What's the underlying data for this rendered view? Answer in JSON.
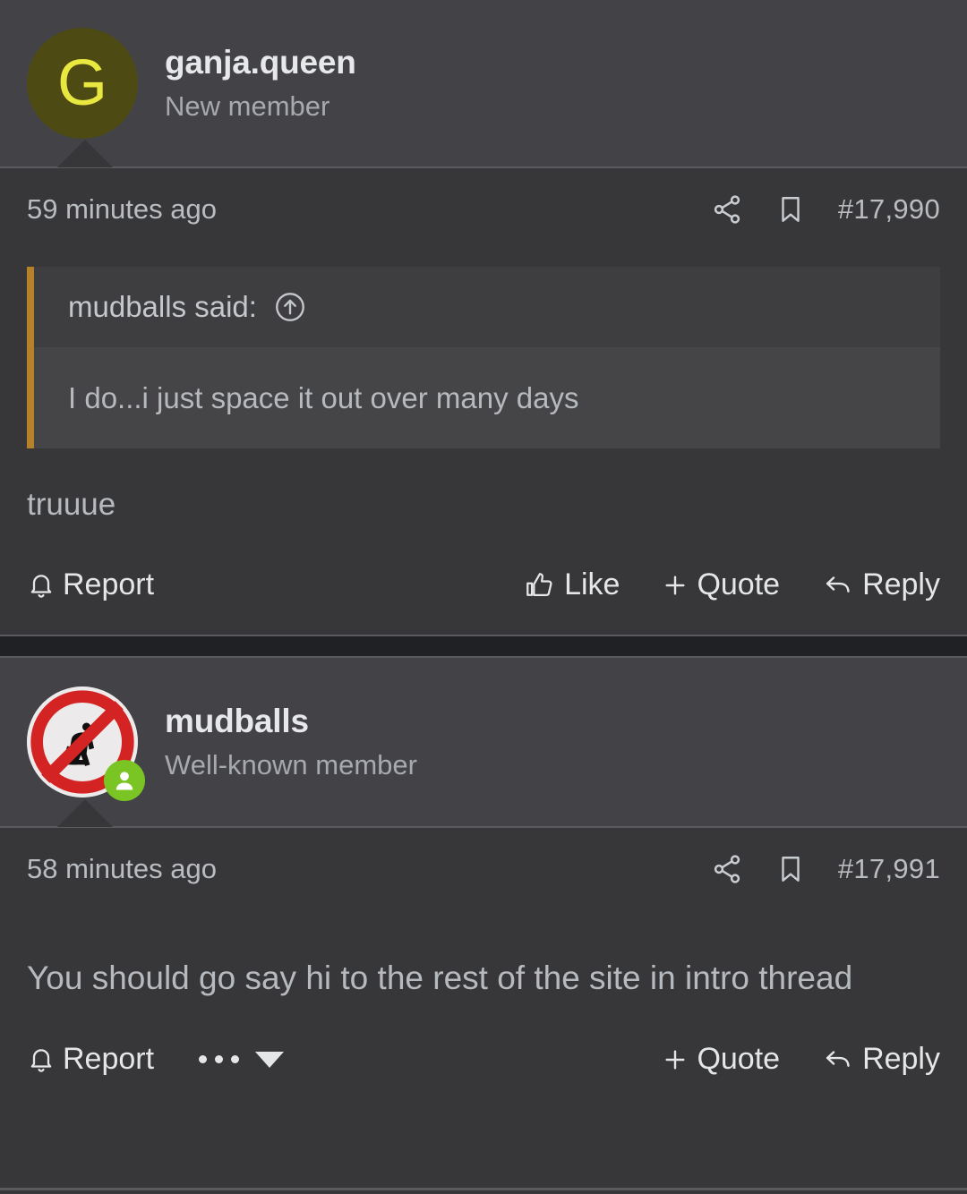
{
  "posts": [
    {
      "author": {
        "username": "ganja.queen",
        "title": "New member",
        "avatar_type": "letter",
        "avatar_letter": "G",
        "avatar_bg": "#4d4a13",
        "avatar_fg": "#e8e840",
        "online": false
      },
      "timestamp": "59 minutes ago",
      "post_number": "#17,990",
      "quote": {
        "author_line": "mudballs said:",
        "text": "I do...i just space it out over many days",
        "jump_icon": "circle-up-arrow-icon",
        "border_color": "#b5822a"
      },
      "message": "truuue",
      "actions_left": [
        {
          "icon": "bell-icon",
          "label": "Report"
        }
      ],
      "actions_right": [
        {
          "icon": "thumbs-up-icon",
          "label": "Like"
        },
        {
          "icon": "plus-icon",
          "label": "Quote"
        },
        {
          "icon": "reply-arrow-icon",
          "label": "Reply"
        }
      ],
      "has_more_menu": false
    },
    {
      "author": {
        "username": "mudballs",
        "title": "Well-known member",
        "avatar_type": "image",
        "avatar_alt": "no-kneeling-prohibition-sign",
        "online": true,
        "online_badge_color": "#7ac423"
      },
      "timestamp": "58 minutes ago",
      "post_number": "#17,991",
      "quote": null,
      "message": "You should go say hi to the rest of the site in intro thread",
      "actions_left": [
        {
          "icon": "bell-icon",
          "label": "Report"
        }
      ],
      "actions_right": [
        {
          "icon": "plus-icon",
          "label": "Quote"
        },
        {
          "icon": "reply-arrow-icon",
          "label": "Reply"
        }
      ],
      "has_more_menu": true
    }
  ],
  "meta_icons": {
    "share": "share-icon",
    "bookmark": "bookmark-icon"
  },
  "colors": {
    "header_bg": "#434347",
    "body_bg": "#373739",
    "gap_bg": "#1f2124",
    "quote_accent": "#b5822a",
    "text_primary": "#e7e8ea",
    "text_secondary": "#b6b9bd",
    "text_muted": "#a6a9ad",
    "online_green": "#7ac423"
  }
}
